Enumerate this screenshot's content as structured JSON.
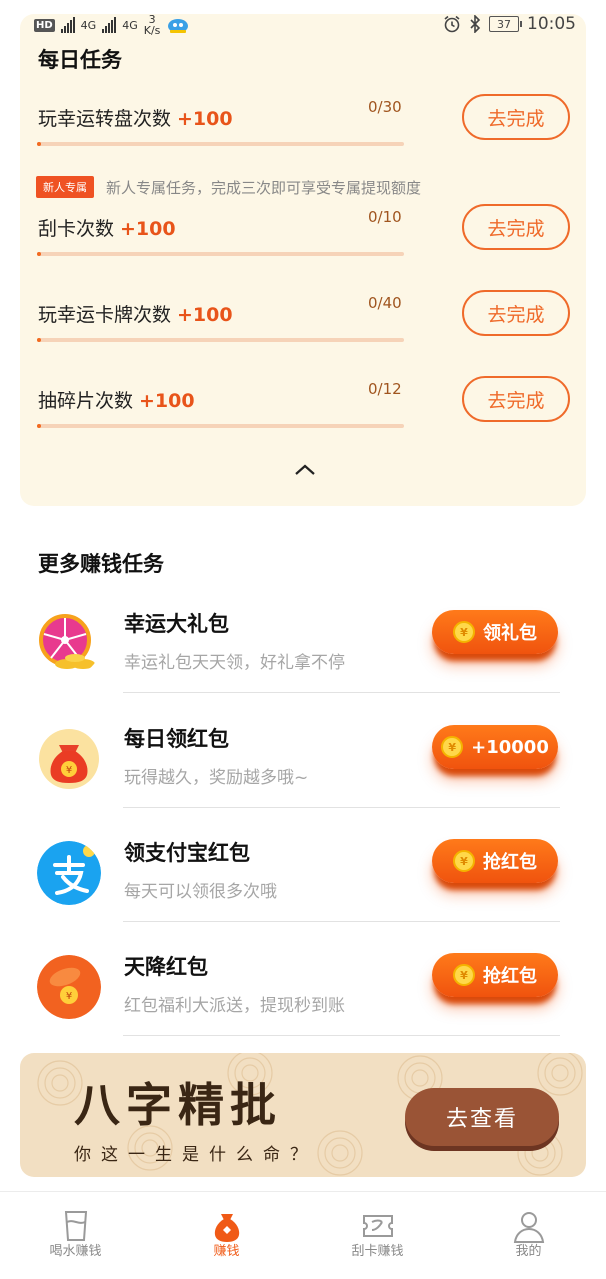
{
  "status_bar": {
    "hd": "HD",
    "net_1": "4G",
    "net_2": "4G",
    "speed_value": "3",
    "speed_unit": "K/s",
    "battery": "37",
    "time": "10:05"
  },
  "daily": {
    "title": "每日任务",
    "tasks": [
      {
        "name": "玩幸运转盘次数",
        "points": "+100",
        "count": "0/30",
        "progress": 0.0,
        "button": "去完成"
      },
      {
        "name": "刮卡次数",
        "points": "+100",
        "count": "0/10",
        "progress": 0.0,
        "button": "去完成"
      },
      {
        "name": "玩幸运卡牌次数",
        "points": "+100",
        "count": "0/40",
        "progress": 0.0,
        "button": "去完成"
      },
      {
        "name": "抽碎片次数",
        "points": "+100",
        "count": "0/12",
        "progress": 0.0,
        "button": "去完成"
      }
    ],
    "newbie_tag": "新人专属",
    "newbie_text": "新人专属任务，完成三次即可享受专属提现额度"
  },
  "more": {
    "title": "更多赚钱任务",
    "items": [
      {
        "icon": "lucky-wheel-icon",
        "title": "幸运大礼包",
        "subtitle": "幸运礼包天天领，好礼拿不停",
        "button": "领礼包"
      },
      {
        "icon": "money-bag-icon",
        "title": "每日领红包",
        "subtitle": "玩得越久，奖励越多哦~",
        "button": "+10000"
      },
      {
        "icon": "alipay-icon",
        "title": "领支付宝红包",
        "subtitle": "每天可以领很多次哦",
        "button": "抢红包"
      },
      {
        "icon": "red-packet-icon",
        "title": "天降红包",
        "subtitle": "红包福利大派送，提现秒到账",
        "button": "抢红包"
      }
    ],
    "coin_symbol": "¥"
  },
  "banner": {
    "title": "八字精批",
    "subtitle": "你这一生是什么命？",
    "button": "去查看"
  },
  "nav": {
    "items": [
      {
        "label": "喝水赚钱",
        "icon": "cup-icon",
        "active": false
      },
      {
        "label": "赚钱",
        "icon": "money-bag-icon",
        "active": true
      },
      {
        "label": "刮卡赚钱",
        "icon": "scratch-card-icon",
        "active": false
      },
      {
        "label": "我的",
        "icon": "user-icon",
        "active": false
      }
    ]
  },
  "colors": {
    "accent": "#f05a16",
    "card_bg": "#fdf7e6",
    "progress_track": "#f6d3b8"
  }
}
